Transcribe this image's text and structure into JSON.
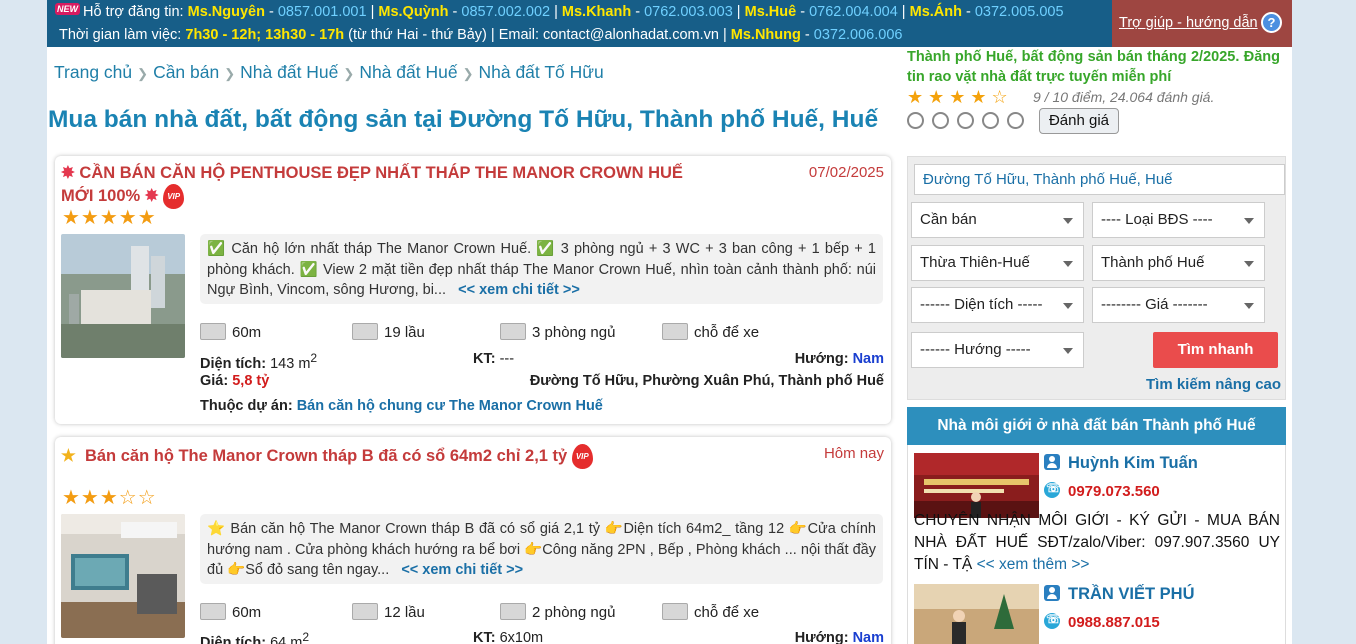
{
  "topbar": {
    "new_badge": "NEW",
    "support_label": "Hỗ trợ đăng tin:",
    "contacts": [
      {
        "name": "Ms.Nguyên",
        "phone": "0857.001.001"
      },
      {
        "name": "Ms.Quỳnh",
        "phone": "0857.002.002"
      },
      {
        "name": "Ms.Khanh",
        "phone": "0762.003.003"
      },
      {
        "name": "Ms.Huê",
        "phone": "0762.004.004"
      },
      {
        "name": "Ms.Ánh",
        "phone": "0372.005.005"
      }
    ],
    "hours_label": "Thời gian làm việc:",
    "hours": "7h30 - 12h; 13h30 - 17h",
    "days": "(từ thứ Hai - thứ Bảy) | Email: contact@alonhadat.com.vn |",
    "extra_contact": {
      "name": "Ms.Nhung",
      "phone": "0372.006.006"
    }
  },
  "help": {
    "label": "Trợ giúp - hướng dẫn",
    "icon": "?"
  },
  "breadcrumb": [
    "Trang chủ",
    "Cần bán",
    "Nhà đất Huế",
    "Nhà đất Huế",
    "Nhà đất Tố Hữu"
  ],
  "page_title": "Mua bán nhà đất, bất động sản tại Đường Tố Hữu, Thành phố Huế, Huế",
  "rating": {
    "title": "Thành phố Huế, bất động sản bán tháng 2/2025. Đăng tin rao vặt nhà đất trực tuyến miễn phí",
    "stars": "★★★★☆",
    "summary": "9 / 10 điểm, 24.064 đánh giá.",
    "button": "Đánh giá"
  },
  "search": {
    "location_value": "Đường Tố Hữu, Thành phố Huế, Huế",
    "transaction": "Cần bán",
    "property_type": "---- Loại BĐS ----",
    "province": "Thừa Thiên-Huế",
    "district": "Thành phố Huế",
    "area": "------ Diện tích -----",
    "price": "-------- Giá -------",
    "direction": "------ Hướng -----",
    "submit": "Tìm nhanh",
    "advanced": "Tìm kiếm nâng cao"
  },
  "brokers": {
    "heading": "Nhà môi giới ở nhà đất bán Thành phố Huế",
    "items": [
      {
        "name": "Huỳnh Kim Tuấn",
        "phone": "0979.073.560",
        "desc": "CHUYÊN NHẬN MÔI GIỚI - KÝ GỬI - MUA BÁN NHÀ ĐẤT HUẾ SĐT/zalo/Viber: 097.907.3560 UY TÍN - TẬ",
        "more": "<< xem thêm >>"
      },
      {
        "name": "TRẦN VIẾT PHÚ",
        "phone": "0988.887.015"
      }
    ]
  },
  "listings": [
    {
      "title": "CẦN BÁN CĂN HỘ PENTHOUSE ĐẸP NHẤT THÁP THE MANOR CROWN HUẾ MỚI 100%",
      "date": "07/02/2025",
      "stars": "★★★★★",
      "desc": "✅ Căn hộ lớn nhất tháp The Manor Crown Huế. ✅ 3 phòng ngủ + 3 WC + 3 ban công + 1 bếp + 1 phòng khách. ✅ View 2 mặt tiền đẹp nhất tháp The Manor Crown Huế, nhìn toàn cảnh thành phố: núi Ngự Bình, Vincom, sông Hương, bi...",
      "more": "<< xem chi tiết >>",
      "road": "60m",
      "floors": "19 lầu",
      "bedrooms": "3 phòng ngủ",
      "parking": "chỗ để xe",
      "area_label": "Diện tích:",
      "area": "143 m",
      "size_label": "KT:",
      "size": "---",
      "dir_label": "Hướng:",
      "direction": "Nam",
      "price_label": "Giá:",
      "price": "5,8 tỷ",
      "address": "Đường Tố Hữu, Phường Xuân Phú, Thành phố Huế",
      "project_label": "Thuộc dự án:",
      "project_prefix": "Bán căn hộ chung cư",
      "project": "The Manor Crown Huế"
    },
    {
      "title": "Bán căn hộ The Manor Crown tháp B đã có sổ 64m2 chỉ 2,1 tỷ",
      "date": "Hôm nay",
      "stars": "★★★☆☆",
      "desc": "⭐ Bán căn hộ The Manor Crown tháp B đã có sổ giá 2,1 tỷ 👉Diện tích 64m2_ tầng 12 👉Cửa chính hướng nam . Cửa phòng khách hướng ra bể bơi 👉Công năng 2PN , Bếp , Phòng khách ... nội thất đầy đủ 👉Sổ đỏ sang tên ngay...",
      "more": "<< xem chi tiết >>",
      "road": "60m",
      "floors": "12 lầu",
      "bedrooms": "2 phòng ngủ",
      "parking": "chỗ để xe",
      "area_label": "Diện tích:",
      "area": "64 m",
      "size_label": "KT:",
      "size": "6x10m",
      "dir_label": "Hướng:",
      "direction": "Nam"
    }
  ],
  "vip_badge": "VIP"
}
